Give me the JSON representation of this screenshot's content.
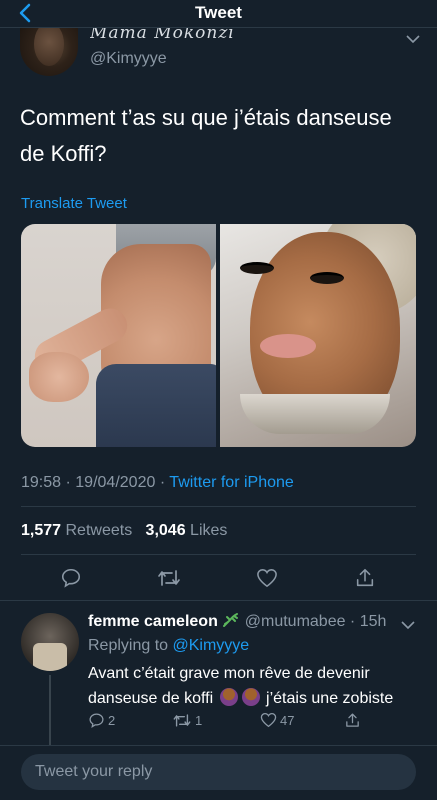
{
  "header": {
    "title": "Tweet"
  },
  "tweet": {
    "author_name": "Mama Mokonzi",
    "author_handle": "@Kimyyye",
    "text": "Comment t’as su que j’étais danseuse de Koffi?",
    "translate_label": "Translate Tweet",
    "time": "19:58",
    "date": "19/04/2020",
    "source": "Twitter for iPhone",
    "retweets_count": "1,577",
    "retweets_label": "Retweets",
    "likes_count": "3,046",
    "likes_label": "Likes"
  },
  "reply": {
    "name": "femme cameleon",
    "handle": "@mutumabee",
    "age": "15h",
    "replying_prefix": "Replying to",
    "replying_to": "@Kimyyye",
    "text_part1": "Avant c’était grave mon rêve de devenir danseuse de koffi",
    "text_part2": "j’étais une zobiste",
    "reply_count": "2",
    "retweet_count": "1",
    "like_count": "47"
  },
  "composer": {
    "placeholder": "Tweet your reply"
  },
  "colors": {
    "background": "#15202b",
    "accent": "#1d9bf0",
    "muted": "#8b98a5",
    "divider": "#2b3945"
  },
  "icons": [
    "back-arrow",
    "chevron-down",
    "reply",
    "retweet",
    "like-heart",
    "share",
    "gecko-emoji",
    "woman-gesturing-emoji"
  ]
}
